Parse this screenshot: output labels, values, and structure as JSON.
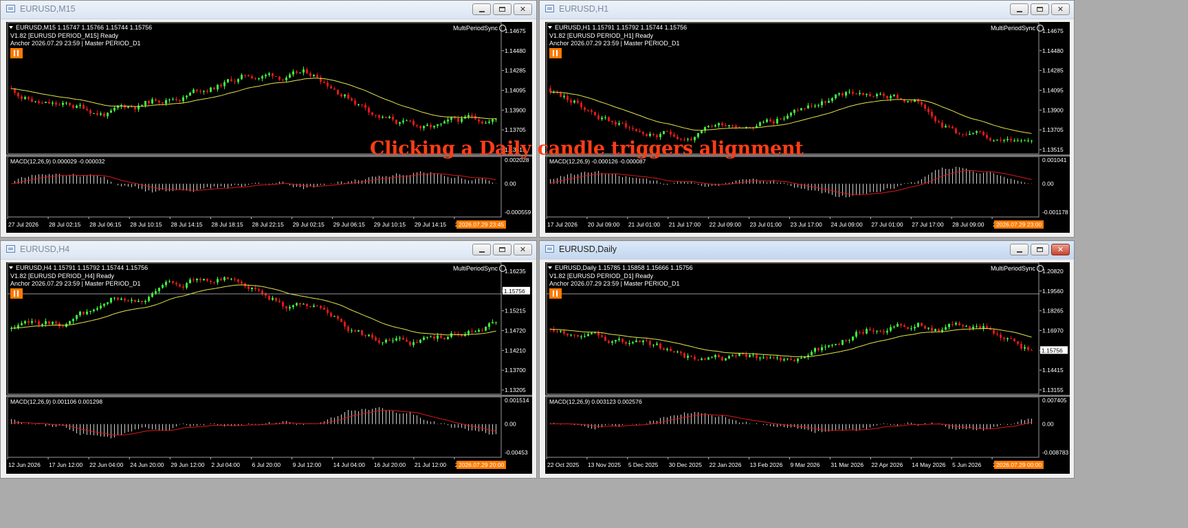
{
  "overlay_text": "Clicking a Daily candle triggers alignment",
  "windows": [
    {
      "id": "m15",
      "title": "EURUSD,M15",
      "active": false,
      "header": {
        "symbol_line": "EURUSD,M15  1.15747 1.15766 1.15744 1.15756",
        "status_line": "V1.82 [EURUSD PERIOD_M15] Ready",
        "anchor_line": "Anchor 2026.07.29 23:59 | Master PERIOD_D1"
      },
      "indicator_name": "MultiPeriodSync",
      "price_axis": [
        "1.14675",
        "1.14480",
        "1.14285",
        "1.14095",
        "1.13900",
        "1.13705",
        "1.13515"
      ],
      "price_marker": "",
      "macd_label": "MACD(12,26,9) 0.000029 -0.000032",
      "macd_axis": [
        "0.002028",
        "0.00",
        "-0.000559"
      ],
      "time_axis": [
        "27 Jul 2026",
        "28 Jul 02:15",
        "28 Jul 06:15",
        "28 Jul 10:15",
        "28 Jul 14:15",
        "28 Jul 18:15",
        "28 Jul 22:15",
        "29 Jul 02:15",
        "29 Jul 06:15",
        "29 Jul 10:15",
        "29 Jul 14:15",
        "29 Jul 18:15"
      ],
      "time_marker": "2026.07.29 23:45",
      "seed": 11
    },
    {
      "id": "h1",
      "title": "EURUSD,H1",
      "active": false,
      "header": {
        "symbol_line": "EURUSD,H1  1.15791 1.15792 1.15744 1.15756",
        "status_line": "V1.82 [EURUSD PERIOD_H1] Ready",
        "anchor_line": "Anchor 2026.07.29 23:59 | Master PERIOD_D1"
      },
      "indicator_name": "MultiPeriodSync",
      "price_axis": [
        "1.14675",
        "1.14480",
        "1.14285",
        "1.14095",
        "1.13900",
        "1.13705",
        "1.13515"
      ],
      "price_marker": "",
      "macd_label": "MACD(12,26,9) -0.000126 -0.000087",
      "macd_axis": [
        "0.001041",
        "0.00",
        "-0.001178"
      ],
      "time_axis": [
        "17 Jul 2026",
        "20 Jul 09:00",
        "21 Jul 01:00",
        "21 Jul 17:00",
        "22 Jul 09:00",
        "23 Jul 01:00",
        "23 Jul 17:00",
        "24 Jul 09:00",
        "27 Jul 01:00",
        "27 Jul 17:00",
        "28 Jul 09:00",
        "29 Jul 01:00"
      ],
      "time_marker": "2026.07.29 23:00",
      "seed": 23
    },
    {
      "id": "h4",
      "title": "EURUSD,H4",
      "active": false,
      "header": {
        "symbol_line": "EURUSD,H4  1.15791 1.15792 1.15744 1.15756",
        "status_line": "V1.82 [EURUSD PERIOD_H4] Ready",
        "anchor_line": "Anchor 2026.07.29 23:59 | Master PERIOD_D1"
      },
      "indicator_name": "MultiPeriodSync",
      "price_axis": [
        "1.16235",
        "1.15756",
        "1.15215",
        "1.14720",
        "1.14210",
        "1.13700",
        "1.13205"
      ],
      "price_marker": "1.15756",
      "macd_label": "MACD(12,26,9) 0.001106 0.001298",
      "macd_axis": [
        "0.001514",
        "0.00",
        "-0.00453"
      ],
      "time_axis": [
        "12 Jun 2026",
        "17 Jun 12:00",
        "22 Jun 04:00",
        "24 Jun 20:00",
        "29 Jun 12:00",
        "2 Jul 04:00",
        "6 Jul 20:00",
        "9 Jul 12:00",
        "14 Jul 04:00",
        "16 Jul 20:00",
        "21 Jul 12:00",
        "24 Jul 04:00"
      ],
      "time_marker": "2026.07.29 20:00",
      "seed": 37
    },
    {
      "id": "d1",
      "title": "EURUSD,Daily",
      "active": true,
      "header": {
        "symbol_line": "EURUSD,Daily  1.15785 1.15858 1.15666 1.15756",
        "status_line": "V1.82 [EURUSD PERIOD_D1] Ready",
        "anchor_line": "Anchor 2026.07.29 23:59 | Master PERIOD_D1"
      },
      "indicator_name": "MultiPeriodSync",
      "price_axis": [
        "1.20820",
        "1.19560",
        "1.18265",
        "1.16970",
        "1.15756",
        "1.14415",
        "1.13155"
      ],
      "price_marker": "1.15756",
      "macd_label": "MACD(12,26,9) 0.003123 0.002576",
      "macd_axis": [
        "0.007405",
        "0.00",
        "-0.008783"
      ],
      "time_axis": [
        "22 Oct 2025",
        "13 Nov 2025",
        "5 Dec 2025",
        "30 Dec 2025",
        "22 Jan 2026",
        "13 Feb 2026",
        "9 Mar 2026",
        "31 Mar 2026",
        "22 Apr 2026",
        "14 May 2026",
        "5 Jun 2026",
        "29 Jun 2026"
      ],
      "time_marker": "2026.07.29 00:00",
      "seed": 53
    }
  ],
  "colors": {
    "bull": "#3df53d",
    "bear": "#e01717",
    "ma": "#e6e64a",
    "signal": "#e01717",
    "hist": "#d0d0d0",
    "accent": "#ff7a00"
  }
}
